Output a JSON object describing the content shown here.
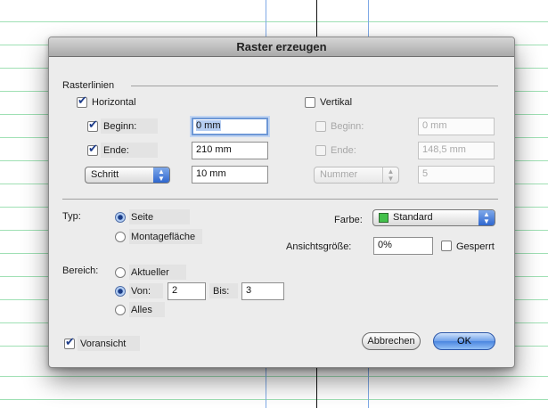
{
  "dialog": {
    "title": "Raster erzeugen",
    "section_label": "Rasterlinien",
    "horizontal": {
      "label": "Horizontal",
      "checked": true,
      "start_label": "Beginn:",
      "start_value": "0 mm",
      "end_label": "Ende:",
      "end_value": "210 mm",
      "mode_popup": "Schritt",
      "mode_value": "10 mm"
    },
    "vertical": {
      "label": "Vertikal",
      "checked": false,
      "start_label": "Beginn:",
      "start_value": "0 mm",
      "end_label": "Ende:",
      "end_value": "148,5 mm",
      "mode_popup": "Nummer",
      "mode_value": "5"
    },
    "type_label": "Typ:",
    "type_options": [
      "Seite",
      "Montagefläche"
    ],
    "color_label": "Farbe:",
    "color_value": "Standard",
    "color_swatch": "#43c14b",
    "view_size_label": "Ansichtsgröße:",
    "view_size_value": "0%",
    "locked_label": "Gesperrt",
    "range_label": "Bereich:",
    "range_current": "Aktueller",
    "range_from_label": "Von:",
    "range_from_value": "2",
    "range_to_label": "Bis:",
    "range_to_value": "3",
    "range_all": "Alles",
    "preview_label": "Voransicht",
    "cancel_label": "Abbrechen",
    "ok_label": "OK"
  }
}
